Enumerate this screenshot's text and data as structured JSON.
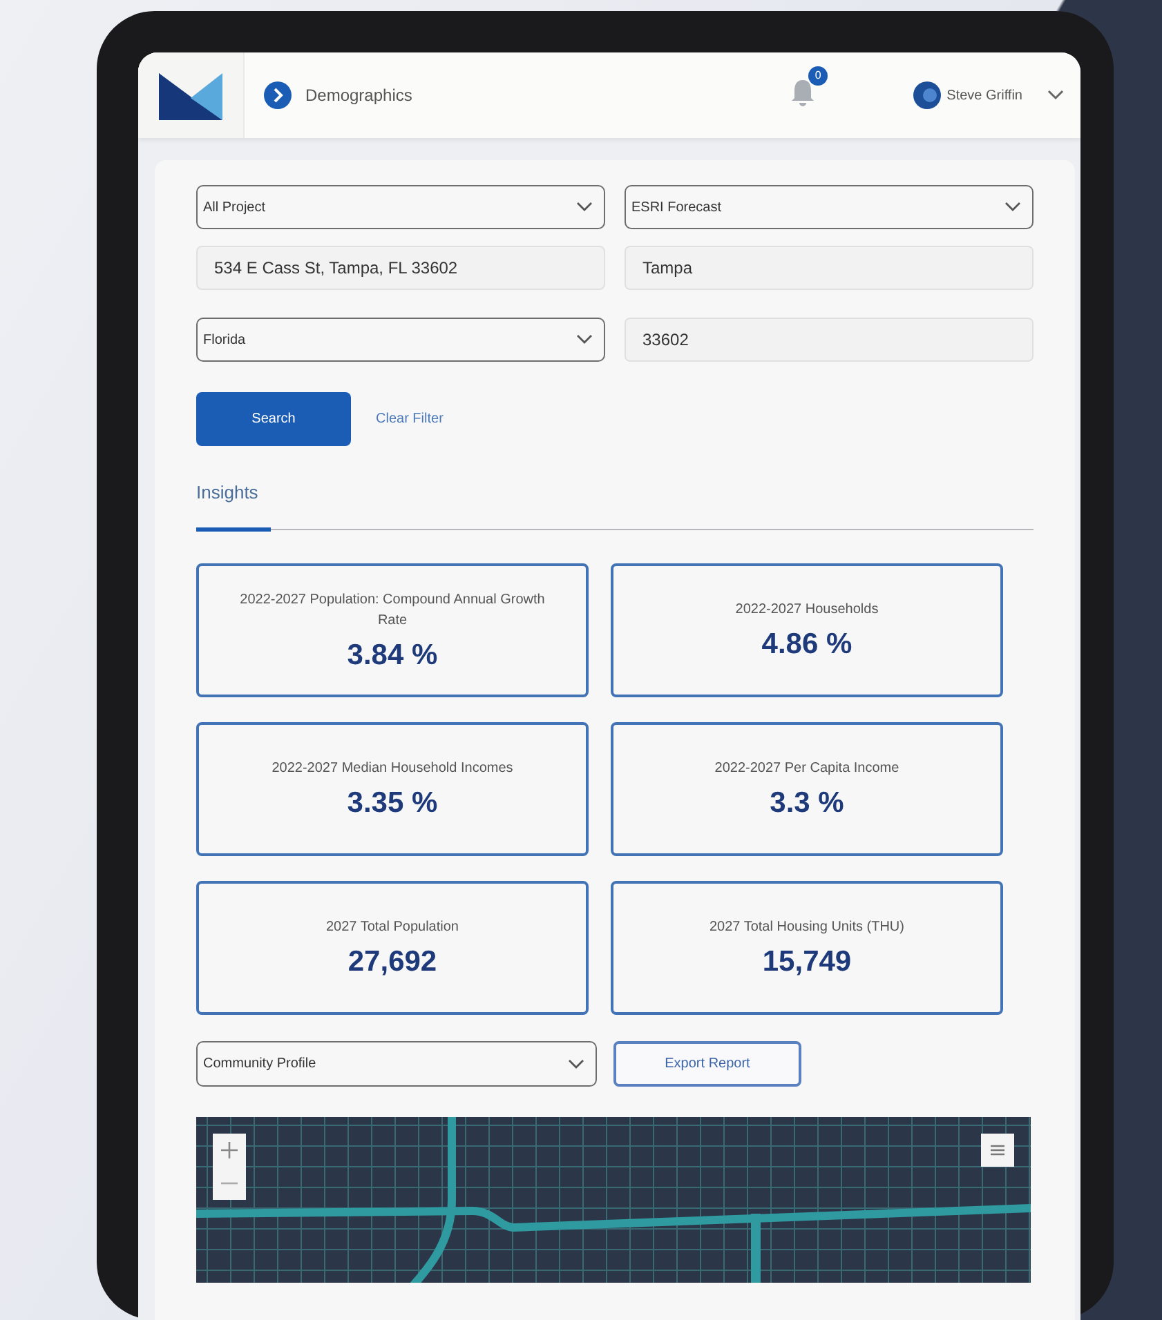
{
  "header": {
    "page_title": "Demographics",
    "notification_count": "0",
    "user_name": "Steve Griffin"
  },
  "filters": [
    {
      "kind": "select",
      "value": "All Project"
    },
    {
      "kind": "select",
      "value": "ESRI Forecast"
    },
    {
      "kind": "input",
      "value": "534 E Cass St, Tampa, FL 33602"
    },
    {
      "kind": "input",
      "value": "Tampa"
    },
    {
      "kind": "select",
      "value": "Florida"
    },
    {
      "kind": "input",
      "value": "33602"
    }
  ],
  "actions": {
    "search": "Search",
    "clear": "Clear Filter"
  },
  "tabs": [
    {
      "label": "Insights",
      "selected": true
    }
  ],
  "metrics": [
    {
      "label": "2022-2027 Population: Compound Annual Growth Rate",
      "value": "3.84 %"
    },
    {
      "label": "2022-2027 Households",
      "value": "4.86 %"
    },
    {
      "label": "2022-2027 Median Household Incomes",
      "value": "3.35 %"
    },
    {
      "label": "2022-2027 Per Capita Income",
      "value": "3.3 %"
    },
    {
      "label": "2027 Total Population",
      "value": "27,692"
    },
    {
      "label": "2027 Total Housing Units (THU)",
      "value": "15,749"
    }
  ],
  "report": {
    "select": "Community Profile",
    "export": "Export Report"
  }
}
